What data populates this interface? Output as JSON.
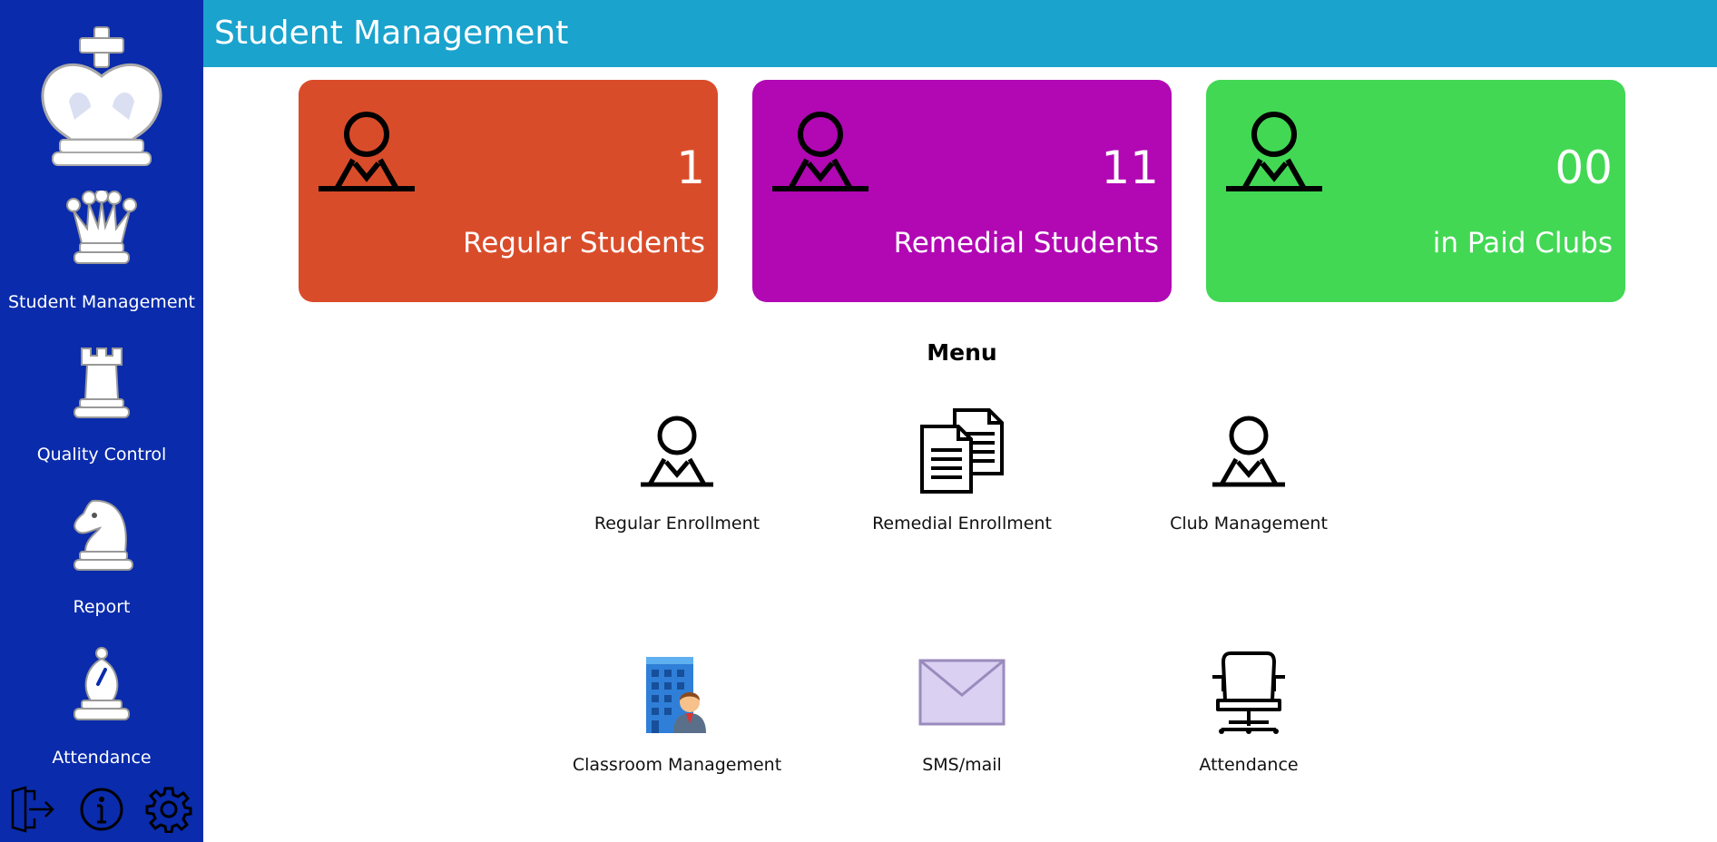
{
  "sidebar": {
    "logo": "chess-king-icon",
    "items": [
      {
        "label": "Student Management",
        "icon": "chess-queen-icon"
      },
      {
        "label": "Quality Control",
        "icon": "chess-rook-icon"
      },
      {
        "label": "Report",
        "icon": "chess-knight-icon"
      },
      {
        "label": "Attendance",
        "icon": "chess-bishop-icon"
      }
    ],
    "footer_icons": [
      "logout-icon",
      "info-icon",
      "settings-icon"
    ]
  },
  "header": {
    "title": "Student Management",
    "color": "#1aa3cd"
  },
  "stats": [
    {
      "count": "1",
      "label": "Regular Students",
      "color": "#d94c2a",
      "icon": "person-icon"
    },
    {
      "count": "11",
      "label": "Remedial Students",
      "color": "#b108b3",
      "icon": "person-icon"
    },
    {
      "count": "00",
      "label": "in Paid Clubs",
      "color": "#42d854",
      "icon": "person-icon"
    }
  ],
  "menu": {
    "title": "Menu",
    "items": [
      {
        "label": "Regular Enrollment",
        "icon": "person-icon"
      },
      {
        "label": "Remedial Enrollment",
        "icon": "documents-icon"
      },
      {
        "label": "Club Management",
        "icon": "person-icon"
      },
      {
        "label": "Classroom Management",
        "icon": "office-building-icon"
      },
      {
        "label": "SMS/mail",
        "icon": "envelope-icon"
      },
      {
        "label": "Attendance",
        "icon": "office-chair-icon"
      }
    ]
  },
  "colors": {
    "sidebar": "#0a2bab",
    "background": "#ffffff"
  }
}
